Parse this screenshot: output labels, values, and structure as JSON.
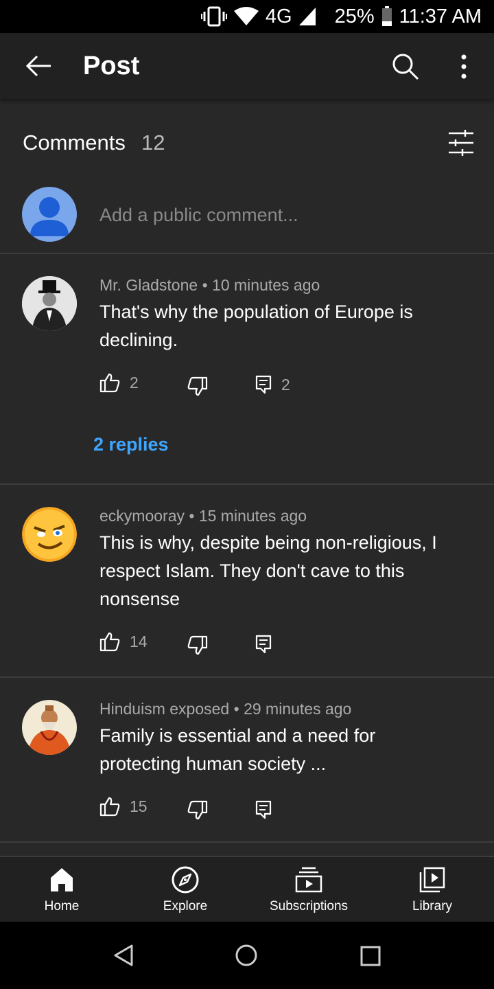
{
  "status_bar": {
    "network": "4G",
    "battery": "25%",
    "time": "11:37 AM"
  },
  "app_bar": {
    "title": "Post"
  },
  "comments_section": {
    "title": "Comments",
    "count": "12",
    "input_placeholder": "Add a public comment..."
  },
  "comments": [
    {
      "author": "Mr. Gladstone",
      "separator": "•",
      "time": "10 minutes ago",
      "text": "That's why the population of Europe is declining.",
      "likes": "2",
      "reply_count": "2",
      "replies_link": "2 replies"
    },
    {
      "author": "eckymooray",
      "separator": "•",
      "time": "15 minutes ago",
      "text": "This is why, despite being non-religious, I respect Islam. They don't cave to this nonsense",
      "likes": "14",
      "reply_count": ""
    },
    {
      "author": "Hinduism exposed",
      "separator": "•",
      "time": "29 minutes ago",
      "text": "Family is essential and a need for protecting human society ...",
      "likes": "15",
      "reply_count": ""
    }
  ],
  "bottom_nav": [
    {
      "label": "Home",
      "icon": "home-icon"
    },
    {
      "label": "Explore",
      "icon": "explore-icon"
    },
    {
      "label": "Subscriptions",
      "icon": "subscriptions-icon"
    },
    {
      "label": "Library",
      "icon": "library-icon"
    }
  ],
  "colors": {
    "background": "#282828",
    "bar": "#212121",
    "link": "#3ea6ff",
    "secondary_text": "#aaaaaa"
  }
}
